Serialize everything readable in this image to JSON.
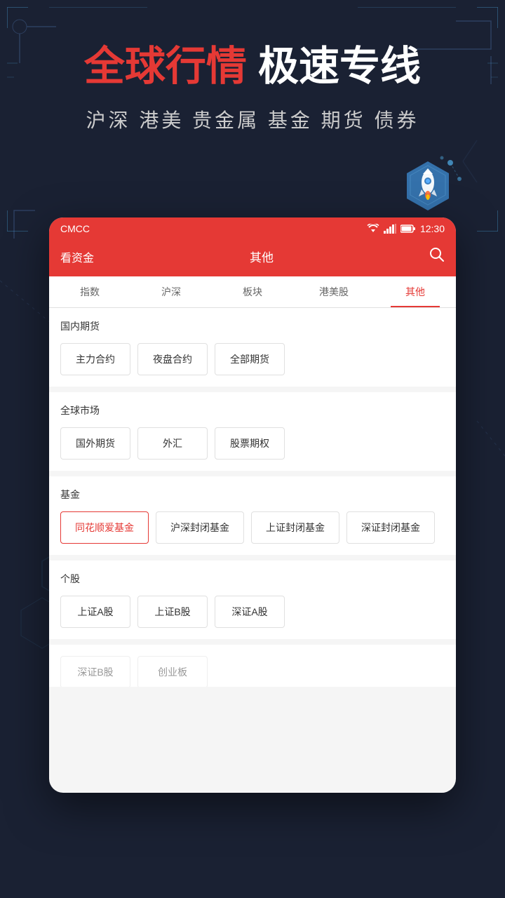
{
  "background": {
    "color": "#1a2133"
  },
  "hero": {
    "title_highlight": "全球行情",
    "title_normal": " 极速专线",
    "subtitle": "沪深 港美 贵金属 基金 期货 债券"
  },
  "status_bar": {
    "carrier": "CMCC",
    "time": "12:30"
  },
  "app_header": {
    "left_label": "看资金",
    "center_label": "其他",
    "search_icon": "search"
  },
  "tabs": [
    {
      "label": "指数",
      "active": false
    },
    {
      "label": "沪深",
      "active": false
    },
    {
      "label": "板块",
      "active": false
    },
    {
      "label": "港美股",
      "active": false
    },
    {
      "label": "其他",
      "active": true
    }
  ],
  "sections": [
    {
      "title": "国内期货",
      "buttons": [
        {
          "label": "主力合约",
          "active": false
        },
        {
          "label": "夜盘合约",
          "active": false
        },
        {
          "label": "全部期货",
          "active": false
        }
      ]
    },
    {
      "title": "全球市场",
      "buttons": [
        {
          "label": "国外期货",
          "active": false
        },
        {
          "label": "外汇",
          "active": false
        },
        {
          "label": "股票期权",
          "active": false
        }
      ]
    },
    {
      "title": "基金",
      "buttons": [
        {
          "label": "同花顺爱基金",
          "active": true
        },
        {
          "label": "沪深封闭基金",
          "active": false
        },
        {
          "label": "上证封闭基金",
          "active": false
        },
        {
          "label": "深证封闭基金",
          "active": false
        }
      ]
    },
    {
      "title": "个股",
      "buttons": [
        {
          "label": "上证A股",
          "active": false
        },
        {
          "label": "上证B股",
          "active": false
        },
        {
          "label": "深证A股",
          "active": false
        }
      ]
    }
  ],
  "bottom_partial": {
    "visible": true
  }
}
